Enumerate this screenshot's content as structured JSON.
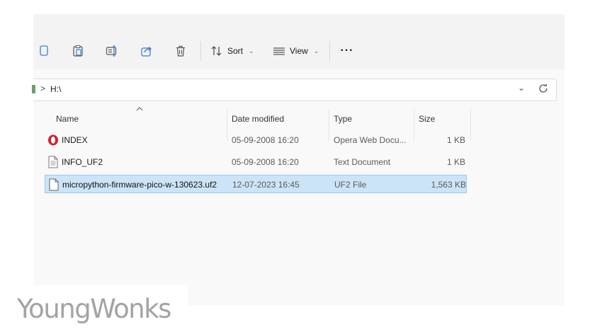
{
  "toolbar": {
    "buttons": [
      {
        "icon": "copy-icon"
      },
      {
        "icon": "paste-icon"
      },
      {
        "icon": "rename-icon"
      },
      {
        "icon": "share-icon"
      },
      {
        "icon": "delete-icon"
      }
    ],
    "sort_label": "Sort",
    "view_label": "View",
    "more_label": "···"
  },
  "address": {
    "chevron": ">",
    "path": "H:\\"
  },
  "columns": {
    "name": "Name",
    "date": "Date modified",
    "type": "Type",
    "size": "Size"
  },
  "files": [
    {
      "name": "INDEX",
      "date": "05-09-2008 16:20",
      "type": "Opera Web Docu...",
      "size": "1 KB",
      "icon": "opera-icon",
      "selected": false
    },
    {
      "name": "INFO_UF2",
      "date": "05-09-2008 16:20",
      "type": "Text Document",
      "size": "1 KB",
      "icon": "text-document-icon",
      "selected": false
    },
    {
      "name": "micropython-firmware-pico-w-130623.uf2",
      "date": "12-07-2023 16:45",
      "type": "UF2 File",
      "size": "1,563 KB",
      "icon": "blank-file-icon",
      "selected": true
    }
  ],
  "watermark": "YoungWonks",
  "colors": {
    "selection": "#cce4f7",
    "selection_border": "#99c9ef",
    "opera_red": "#d81d2a",
    "share_blue": "#3a7bd5"
  }
}
